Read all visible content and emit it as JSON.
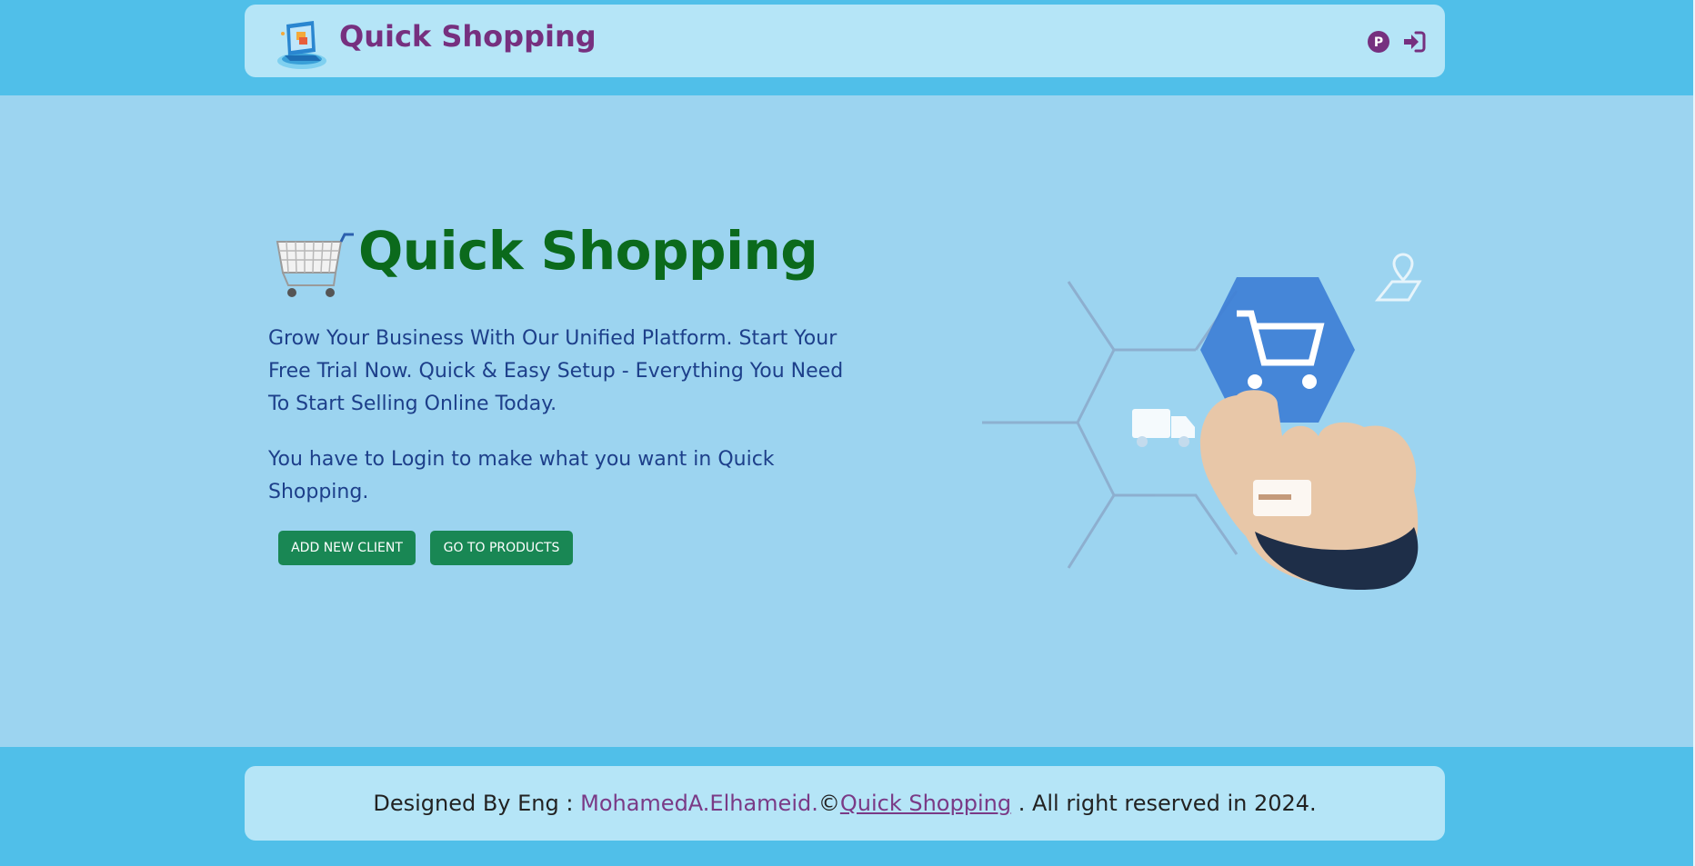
{
  "header": {
    "brand": "Quick Shopping",
    "icons": {
      "profile": "profile-p-icon",
      "login": "login-icon"
    },
    "profile_glyph": "P"
  },
  "hero": {
    "title": "Quick Shopping",
    "description": "Grow Your Business With Our Unified Platform. Start Your Free Trial Now. Quick & Easy Setup - Everything You Need To Start Selling Online Today.",
    "login_note": "You have to Login to make what you want in Quick Shopping.",
    "buttons": {
      "add_client": "ADD NEW CLIENT",
      "products": "GO TO PRODUCTS"
    }
  },
  "footer": {
    "designed_by": "Designed By Eng :",
    "author": "MohamedA.Elhameid.",
    "copyright": "©",
    "link": "Quick Shopping",
    "rights": ". All right reserved in 2024."
  },
  "colors": {
    "band": "#50bfe9",
    "navbar": "#b5e5f7",
    "page_bg": "#9cd4f0",
    "brand": "#76307f",
    "hero_title": "#0b6a1c",
    "text": "#1d3f8a",
    "button": "#198754"
  }
}
